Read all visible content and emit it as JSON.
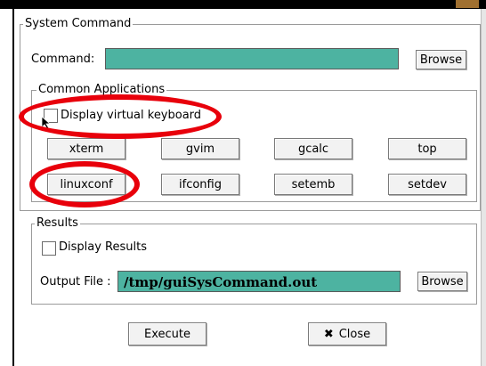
{
  "system_command": {
    "title": "System Command",
    "command_label": "Command:",
    "command_value": "",
    "browse_label": "Browse"
  },
  "common_applications": {
    "title": "Common Applications",
    "display_keyboard_label": "Display virtual keyboard",
    "display_keyboard_checked": false,
    "apps": [
      "xterm",
      "gvim",
      "gcalc",
      "top",
      "linuxconf",
      "ifconfig",
      "setemb",
      "setdev"
    ]
  },
  "results": {
    "title": "Results",
    "display_results_label": "Display Results",
    "display_results_checked": false,
    "output_label": "Output File :",
    "output_value": "/tmp/guiSysCommand.out",
    "browse_label": "Browse"
  },
  "actions": {
    "execute_label": "Execute",
    "close_label": "Close",
    "close_icon": "x-icon"
  },
  "colors": {
    "field": "#4db3a1",
    "highlight": "#e8000b"
  }
}
